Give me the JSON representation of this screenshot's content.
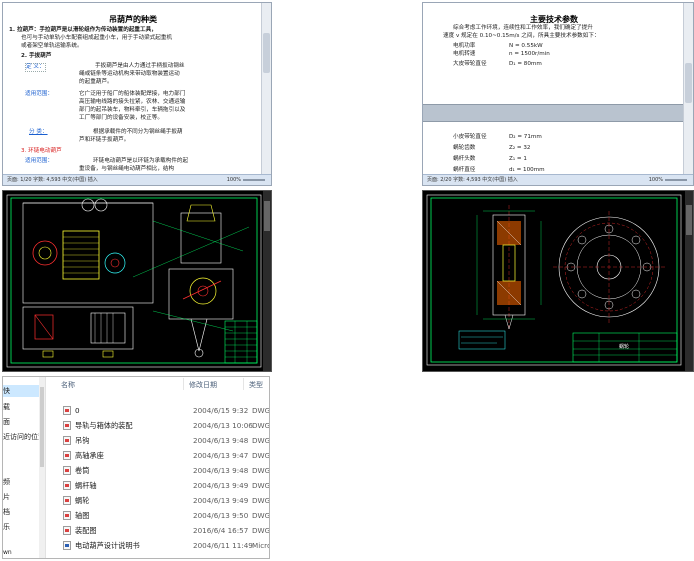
{
  "doc1": {
    "title": "吊葫芦的种类",
    "lines": [
      "1.  拉葫芦：手拉葫芦是以滑轮组作为传动装置的起重工具，",
      "也可与手动单轨小车配套组成起重小车，用于手动梁式起重机",
      "或者架空单轨运输系统。",
      "2.  手拔葫芦",
      "定       义：",
      "手扳葫芦是由人力通过手柄扳动钢丝",
      "绳或链条等运动机构来带动取物装置运动",
      "的起重葫芦。",
      "适用范围：",
      "它广泛用于船厂的船体装配焊接，电力部门",
      "高压输电线路的接头拉紧，农林、交通运输",
      "部门的起吊装车，物料牵引，车辆拖引以及",
      "工厂等部门的设备安装，校正等。",
      "分       类：",
      "根据承载件的不同分为钢丝绳手扳葫",
      "芦和环链手扳葫芦。",
      "3.  环链电动葫芦",
      "适用范围：",
      "环链电动葫芦是以环链为承载构件的起",
      "重设备，与钢丝绳电动葫芦相比，结构"
    ],
    "status": "页面: 1/20   字数: 4,593   中文(中国)   插入",
    "zoom": "100%"
  },
  "doc2": {
    "title": "主要技术参数",
    "lines": [
      "综合考虑工作环境，连续性和工作效率，我们确定了提升",
      "速度 v 规定在 0.10~0.15m/s 之间，所具主要技术参数如下：",
      "电机功率",
      "N = 0.55kW",
      "电机转速",
      "n = 1500r/min",
      "大皮带轮直径",
      "D₁ = 80mm",
      "小皮带轮直径",
      "D₂ = 71mm",
      "蜗轮齿数",
      "Z₂ = 32",
      "蜗杆头数",
      "Z₁ = 1",
      "蜗杆直径",
      "d₁ = 100mm"
    ],
    "status": "页面: 2/20   字数: 4,593   中文(中国)   插入",
    "zoom": "100%"
  },
  "explorer": {
    "nav": [
      "快",
      "载",
      "面",
      "近访问的位置",
      "",
      "",
      "频",
      "片",
      "档",
      "乐",
      "",
      "wn"
    ],
    "headers": {
      "name": "名称",
      "date": "修改日期",
      "type": "类型"
    },
    "files": [
      {
        "name": "0",
        "date": "2004/6/15 9:32",
        "type": "DWG 1",
        "icon": "dwg"
      },
      {
        "name": "导轨与箱体的装配",
        "date": "2004/6/13 10:06",
        "type": "DWG 1",
        "icon": "dwg"
      },
      {
        "name": "吊钩",
        "date": "2004/6/13 9:48",
        "type": "DWG 1",
        "icon": "dwg"
      },
      {
        "name": "高轴承座",
        "date": "2004/6/13 9:47",
        "type": "DWG 1",
        "icon": "dwg"
      },
      {
        "name": "卷筒",
        "date": "2004/6/13 9:48",
        "type": "DWG 1",
        "icon": "dwg"
      },
      {
        "name": "蜗杆轴",
        "date": "2004/6/13 9:49",
        "type": "DWG 1",
        "icon": "dwg"
      },
      {
        "name": "蜗轮",
        "date": "2004/6/13 9:49",
        "type": "DWG 1",
        "icon": "dwg"
      },
      {
        "name": "轴图",
        "date": "2004/6/13 9:50",
        "type": "DWG 1",
        "icon": "dwg"
      },
      {
        "name": "装配图",
        "date": "2016/6/4 16:57",
        "type": "DWG 1",
        "icon": "dwg"
      },
      {
        "name": "电动葫芦设计说明书",
        "date": "2004/6/11 11:49",
        "type": "Micro",
        "icon": "doc"
      }
    ]
  },
  "cad2": {
    "title_text": "蜗轮"
  },
  "colors": {
    "cad_bg": "#000000",
    "cad_green": "#00ff66",
    "cad_yellow": "#ffff33",
    "cad_red": "#ff3030",
    "cad_cyan": "#33ffff",
    "doc_blue": "#1a5fd0",
    "doc_red": "#d81e1e"
  }
}
